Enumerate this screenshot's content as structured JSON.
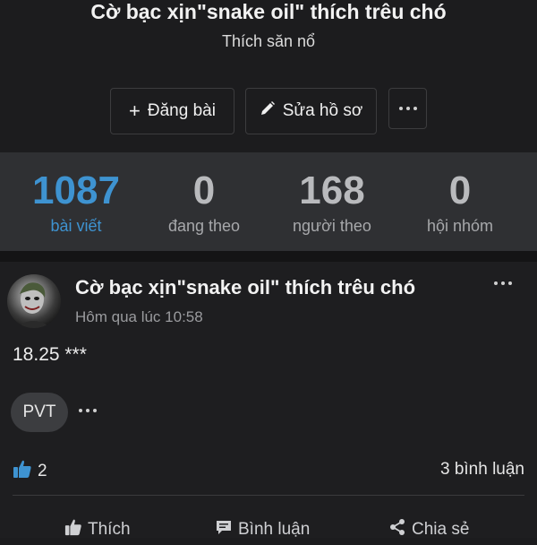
{
  "profile": {
    "name": "Cờ bạc xịn\"snake oil\" thích trêu chó",
    "subtitle": "Thích săn nổ",
    "buttons": {
      "post_label": "Đăng bài",
      "edit_label": "Sửa hồ sơ"
    }
  },
  "stats": [
    {
      "value": "1087",
      "label": "bài viết",
      "active": true
    },
    {
      "value": "0",
      "label": "đang theo",
      "active": false
    },
    {
      "value": "168",
      "label": "người theo",
      "active": false
    },
    {
      "value": "0",
      "label": "hội nhóm",
      "active": false
    }
  ],
  "post": {
    "author": "Cờ bạc xịn\"snake oil\" thích trêu chó",
    "time": "Hôm qua lúc 10:58",
    "text": "18.25 ***",
    "tag": "PVT",
    "likes": "2",
    "comments": "3 bình luận",
    "actions": {
      "like": "Thích",
      "comment": "Bình luận",
      "share": "Chia sẻ"
    }
  },
  "colors": {
    "accent": "#3e93d1",
    "background": "#1c1c1e",
    "stats_bar": "#2f3033"
  },
  "icons": [
    "plus-icon",
    "pencil-icon",
    "more-icon",
    "thumbs-up-icon",
    "comment-icon",
    "share-icon"
  ]
}
